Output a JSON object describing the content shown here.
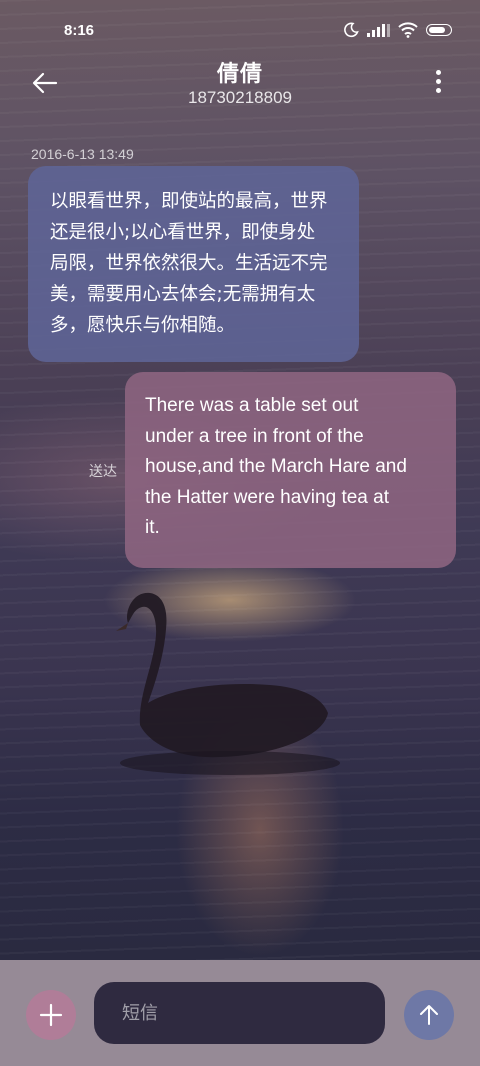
{
  "status_bar": {
    "time": "8:16",
    "icons": [
      "moon-icon",
      "signal-icon",
      "wifi-icon",
      "battery-icon"
    ]
  },
  "header": {
    "contact_name": "倩倩",
    "contact_number": "18730218809",
    "back_icon": "back-arrow-icon",
    "more_icon": "more-vertical-icon"
  },
  "conversation": {
    "timestamp": "2016-6-13 13:49",
    "incoming_message": {
      "lines": [
        "以眼看世界，即使站的最高，世界",
        "还是很小;以心看世界，即使身处",
        "局限，世界依然很大。生活远不完",
        "美，需要用心去体会;无需拥有太",
        "多，愿快乐与你相随。"
      ]
    },
    "outgoing_message": {
      "lines": [
        "There was a table set out",
        "under a tree in front of the",
        "house,and the March Hare and",
        "the Hatter were having tea at",
        "it."
      ],
      "status": "送达"
    }
  },
  "composer": {
    "placeholder": "短信",
    "add_icon": "plus-icon",
    "send_icon": "arrow-up-icon"
  },
  "colors": {
    "incoming_bubble": "#5e6496",
    "outgoing_bubble": "#8c6480",
    "bottom_bar": "#968a96",
    "input_bg": "#2f2a40",
    "add_button": "#b07d98",
    "send_button": "#6e78a6"
  }
}
